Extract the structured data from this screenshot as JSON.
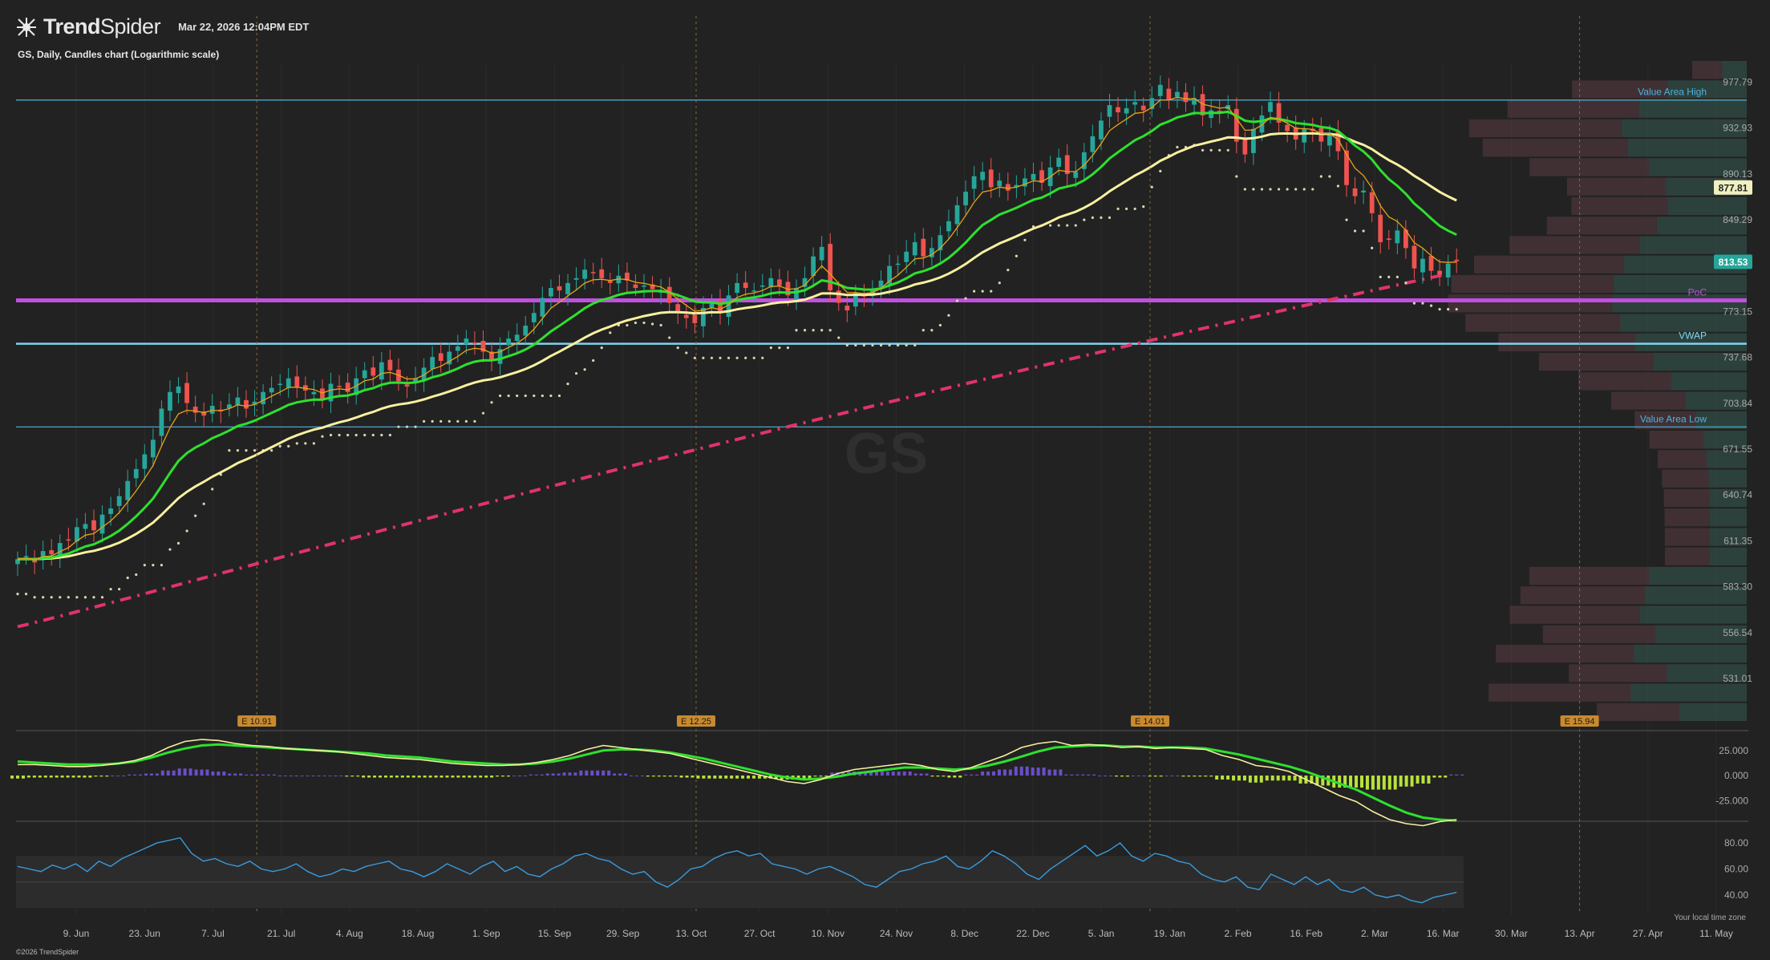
{
  "header": {
    "brand_bold": "Trend",
    "brand_light": "Spider",
    "timestamp": "Mar 22, 2026 12:04PM EDT",
    "subtitle": "GS, Daily, Candles chart (Logarithmic scale)"
  },
  "footer": {
    "copyright": "©2026 TrendSpider",
    "timezone_note": "Your local time zone"
  },
  "colors": {
    "background": "#222222",
    "candle_up": "#26a69a",
    "candle_down": "#ef5350",
    "ema_fast": "#e8a317",
    "ema_mid": "#2ee02e",
    "ema_slow": "#f7f0a0",
    "sma200": "#e0336a",
    "poc_line": "#c050e0",
    "value_area_line": "#4fb3e0",
    "vwap_line": "#7fd3f0",
    "macd_hist_pos": "#6a4ec8",
    "macd_hist_neg": "#b8e23a",
    "rsi_line": "#3a9bdc",
    "price_badge_last": "#26a69a",
    "price_badge_ema": "#f0f0c0"
  },
  "chart_data": {
    "type": "candlestick",
    "symbol": "GS",
    "timeframe": "Daily",
    "scale": "log",
    "ylim": [
      508,
      1000
    ],
    "y_ticks": [
      977.79,
      932.93,
      890.13,
      849.29,
      773.15,
      737.68,
      703.84,
      671.55,
      640.74,
      611.35,
      583.3,
      556.54,
      531.01
    ],
    "price_badges": [
      {
        "value": 877.81,
        "label": "877.81",
        "kind": "ema"
      },
      {
        "value": 813.53,
        "label": "813.53",
        "kind": "last"
      }
    ],
    "x_tick_labels": [
      "9. Jun",
      "23. Jun",
      "7. Jul",
      "21. Jul",
      "4. Aug",
      "18. Aug",
      "1. Sep",
      "15. Sep",
      "29. Sep",
      "13. Oct",
      "27. Oct",
      "10. Nov",
      "24. Nov",
      "8. Dec",
      "22. Dec",
      "5. Jan",
      "19. Jan",
      "2. Feb",
      "16. Feb",
      "2. Mar",
      "16. Mar",
      "30. Mar",
      "13. Apr",
      "27. Apr",
      "11. May"
    ],
    "levels": [
      {
        "name": "Value Area High",
        "label": "Value Area High",
        "value": 960
      },
      {
        "name": "PoC",
        "label": "PoC",
        "value": 782
      },
      {
        "name": "VWAP",
        "label": "VWAP",
        "value": 748
      },
      {
        "name": "Value Area Low",
        "label": "Value Area Low",
        "value": 687
      }
    ],
    "earnings": [
      {
        "date": "2025-07-16",
        "label": "E 10.91"
      },
      {
        "date": "2025-10-14",
        "label": "E 12.25"
      },
      {
        "date": "2026-01-15",
        "label": "E 14.01"
      },
      {
        "date": "2026-04-13",
        "label": "E 15.94"
      }
    ],
    "closes": [
      600,
      602,
      598,
      605,
      603,
      610,
      612,
      620,
      622,
      618,
      628,
      632,
      640,
      650,
      658,
      668,
      678,
      700,
      712,
      716,
      704,
      697,
      695,
      702,
      698,
      703,
      708,
      700,
      705,
      712,
      715,
      718,
      722,
      716,
      713,
      712,
      706,
      718,
      716,
      712,
      722,
      728,
      724,
      734,
      728,
      720,
      716,
      722,
      730,
      738,
      735,
      742,
      746,
      752,
      748,
      742,
      735,
      744,
      752,
      755,
      762,
      772,
      784,
      792,
      790,
      796,
      800,
      807,
      804,
      800,
      796,
      802,
      798,
      792,
      794,
      791,
      790,
      780,
      772,
      768,
      764,
      776,
      780,
      772,
      786,
      796,
      792,
      790,
      794,
      800,
      794,
      786,
      792,
      800,
      818,
      826,
      790,
      780,
      774,
      788,
      786,
      790,
      798,
      810,
      812,
      822,
      830,
      818,
      825,
      836,
      848,
      862,
      874,
      888,
      892,
      878,
      884,
      875,
      880,
      886,
      890,
      882,
      896,
      905,
      890,
      892,
      910,
      925,
      940,
      955,
      948,
      952,
      958,
      950,
      962,
      975,
      960,
      968,
      958,
      962,
      945,
      950,
      948,
      955,
      920,
      908,
      932,
      945,
      958,
      938,
      930,
      922,
      932,
      930,
      920,
      927,
      911,
      880,
      870,
      875,
      855,
      830,
      832,
      840,
      825,
      808,
      816,
      806,
      803,
      812,
      814
    ],
    "macd_series": [
      {
        "name": "MACD",
        "values": [
          11,
          11,
          10,
          9,
          9,
          10,
          12,
          15,
          20,
          28,
          34,
          36,
          35,
          32,
          30,
          29,
          27,
          26,
          25,
          24,
          22,
          20,
          18,
          17,
          16,
          14,
          12,
          11,
          10,
          10,
          11,
          13,
          16,
          20,
          26,
          30,
          28,
          26,
          24,
          22,
          18,
          14,
          10,
          6,
          2,
          -2,
          -6,
          -8,
          -4,
          2,
          6,
          8,
          10,
          12,
          10,
          6,
          4,
          8,
          14,
          20,
          28,
          32,
          34,
          30,
          31,
          30,
          28,
          29,
          27,
          28,
          27,
          26,
          20,
          16,
          10,
          8,
          4,
          -4,
          -12,
          -20,
          -26,
          -36,
          -44,
          -48,
          -50,
          -46,
          -44
        ]
      },
      {
        "name": "Signal",
        "values": [
          14,
          13,
          12,
          11,
          11,
          11,
          12,
          14,
          18,
          23,
          27,
          30,
          31,
          30,
          29,
          28,
          27,
          26,
          25,
          24,
          23,
          22,
          20,
          19,
          18,
          16,
          14,
          13,
          12,
          11,
          11,
          12,
          14,
          17,
          21,
          25,
          26,
          26,
          25,
          23,
          20,
          17,
          13,
          9,
          5,
          1,
          -2,
          -4,
          -3,
          -1,
          2,
          4,
          6,
          8,
          8,
          7,
          6,
          7,
          10,
          14,
          19,
          24,
          28,
          29,
          30,
          30,
          29,
          29,
          28,
          28,
          28,
          27,
          24,
          21,
          17,
          13,
          9,
          4,
          -2,
          -8,
          -14,
          -22,
          -30,
          -37,
          -42,
          -44,
          -45
        ]
      }
    ],
    "macd_ticks": [
      25,
      0,
      -25
    ],
    "macd_tick_labels": [
      "25.000",
      "0.000",
      "-25.000"
    ],
    "rsi_values": [
      62,
      60,
      58,
      63,
      60,
      64,
      58,
      66,
      62,
      68,
      72,
      76,
      80,
      82,
      84,
      72,
      66,
      68,
      64,
      62,
      66,
      60,
      58,
      60,
      64,
      58,
      54,
      56,
      60,
      58,
      62,
      64,
      66,
      60,
      58,
      54,
      58,
      64,
      60,
      56,
      62,
      66,
      58,
      62,
      56,
      54,
      60,
      64,
      70,
      72,
      68,
      66,
      60,
      56,
      58,
      50,
      46,
      52,
      60,
      62,
      68,
      72,
      74,
      70,
      72,
      64,
      62,
      60,
      56,
      60,
      62,
      58,
      54,
      48,
      46,
      52,
      58,
      60,
      64,
      66,
      70,
      62,
      60,
      66,
      74,
      70,
      64,
      56,
      52,
      60,
      66,
      72,
      78,
      70,
      74,
      80,
      70,
      66,
      72,
      70,
      66,
      64,
      56,
      52,
      50,
      54,
      46,
      44,
      56,
      52,
      48,
      54,
      48,
      52,
      44,
      42,
      46,
      40,
      38,
      40,
      36,
      34,
      38,
      40,
      42
    ],
    "rsi_ticks": [
      80,
      60,
      40
    ],
    "rsi_tick_labels": [
      "80.00",
      "60.00",
      "40.00"
    ],
    "rsi_band": [
      30,
      70
    ]
  }
}
